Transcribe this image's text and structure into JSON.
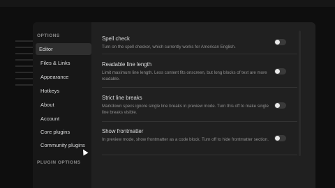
{
  "settings_modal": {
    "sidebar": {
      "options_heading": "OPTIONS",
      "items": [
        {
          "label": "Editor"
        },
        {
          "label": "Files & Links"
        },
        {
          "label": "Appearance"
        },
        {
          "label": "Hotkeys"
        },
        {
          "label": "About"
        },
        {
          "label": "Account"
        },
        {
          "label": "Core plugins"
        },
        {
          "label": "Community plugins"
        }
      ],
      "plugin_options_heading": "PLUGIN OPTIONS"
    },
    "close_icon": "×",
    "settings": [
      {
        "name": "Spell check",
        "description": "Turn on the spell checker, which currently works for American English.",
        "enabled": false
      },
      {
        "name": "Readable line length",
        "description": "Limit maximum line length. Less content fits onscreen, but long blocks of text are more readable.",
        "enabled": false
      },
      {
        "name": "Strict line breaks",
        "description": "Markdown specs ignore single line breaks in preview mode. Turn this off to make single line breaks visible.",
        "enabled": false
      },
      {
        "name": "Show frontmatter",
        "description": "In preview mode, show frontmatter as a code block. Turn off to hide frontmatter section.",
        "enabled": false
      }
    ]
  }
}
